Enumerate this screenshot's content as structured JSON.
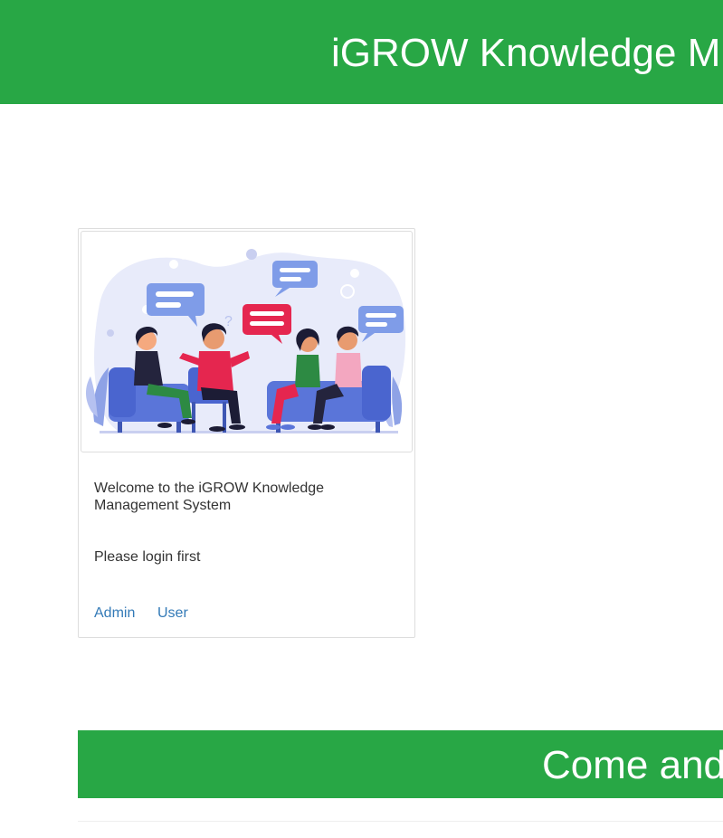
{
  "header": {
    "title": "iGROW Knowledge M"
  },
  "card": {
    "image_icon": "people-discussion-illustration",
    "welcome_text": "Welcome to the iGROW Knowledge Management System",
    "login_note": "Please login first",
    "links": {
      "admin": "Admin",
      "user": "User"
    }
  },
  "banner": {
    "title": "Come and"
  },
  "colors": {
    "brand_green": "#28a745",
    "link_blue": "#337ab7",
    "text": "#333333"
  }
}
